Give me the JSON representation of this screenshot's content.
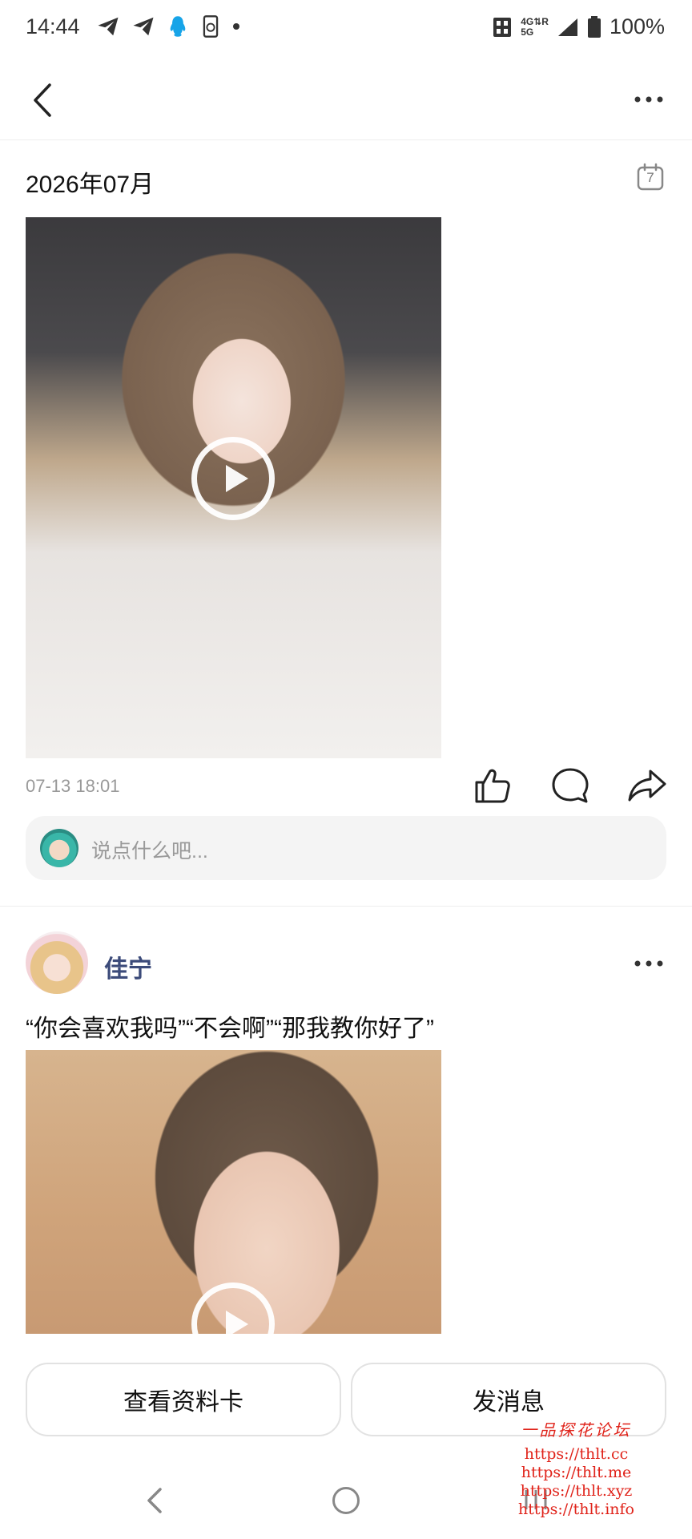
{
  "status_bar": {
    "time": "14:44",
    "network_top": "4G⇅R",
    "network_bottom": "5G",
    "battery": "100%"
  },
  "header": {
    "month": "2026年07月",
    "calendar_day": "7"
  },
  "post1": {
    "timestamp": "07-13 18:01",
    "comment_placeholder": "说点什么吧..."
  },
  "post2": {
    "author": "佳宁",
    "text": "“你会喜欢我吗”“不会啊”“那我教你好了”"
  },
  "actions": {
    "view_profile": "查看资料卡",
    "send_message": "发消息"
  },
  "watermark": {
    "title": "一品探花论坛",
    "urls": [
      "https://thlt.cc",
      "https://thlt.me",
      "https://thlt.xyz",
      "https://thlt.info"
    ]
  },
  "colors": {
    "author_name": "#3c4b7a",
    "watermark": "#e0231a",
    "comment_bg": "#f4f4f4"
  }
}
